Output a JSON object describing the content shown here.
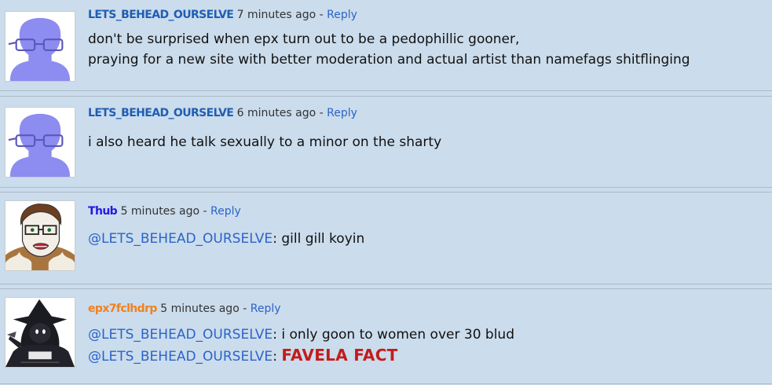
{
  "comments": [
    {
      "username": "LETS_BEHEAD_OURSELVE",
      "time": "7 minutes ago",
      "sep": "-",
      "reply": "Reply",
      "lines": [
        "don't be surprised when epx turn out to be a pedophillic gooner,",
        "praying for a new site with better moderation and actual artist than namefags shitflinging"
      ]
    },
    {
      "username": "LETS_BEHEAD_OURSELVE",
      "time": "6 minutes ago",
      "sep": "-",
      "reply": "Reply",
      "lines": [
        "i also heard he talk sexually to a minor on the sharty"
      ]
    },
    {
      "username": "Thub",
      "time": "5 minutes ago",
      "sep": "-",
      "reply": "Reply",
      "mention": "@LETS_BEHEAD_OURSELVE",
      "colon": ":",
      "text": "gill gill koyin"
    },
    {
      "username": "epx7fclhdrp",
      "time": "5 minutes ago",
      "sep": "-",
      "reply": "Reply",
      "mention1": "@LETS_BEHEAD_OURSELVE",
      "colon1": ":",
      "text1": "i only goon to women over 30 blud",
      "mention2": "@LETS_BEHEAD_OURSELVE",
      "colon2": ":",
      "text2": "FAVELA FACT"
    }
  ],
  "colors": {
    "background": "#cbdcec",
    "username_default": "#1f5eb3",
    "username_thub": "#2418e6",
    "username_epx": "#ef8220",
    "link": "#2b64c8",
    "emphasis_red": "#c41b1b"
  },
  "icons": {
    "default_avatar": "default-avatar-icon",
    "thub_avatar": "cartoon-face-avatar",
    "epx_avatar": "dark-witch-avatar"
  }
}
